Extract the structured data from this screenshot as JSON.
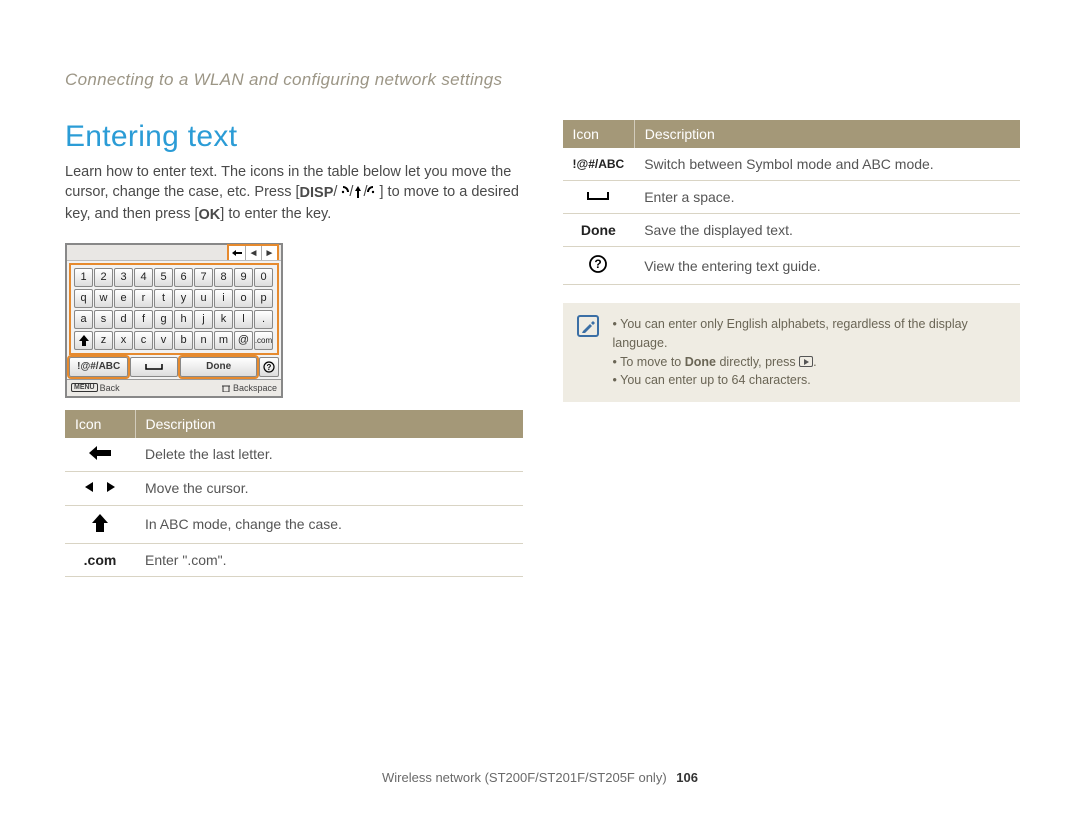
{
  "breadcrumb": "Connecting to a WLAN and configuring network settings",
  "heading": "Entering text",
  "intro_part1": "Learn how to enter text. The icons in the table below let you move the cursor, change the case, etc. Press [",
  "intro_disp": "DISP",
  "intro_part2": "] to move to a desired key, and then press [",
  "intro_ok": "OK",
  "intro_part3": "] to enter the key.",
  "keyboard": {
    "rows": [
      [
        "1",
        "2",
        "3",
        "4",
        "5",
        "6",
        "7",
        "8",
        "9",
        "0"
      ],
      [
        "q",
        "w",
        "e",
        "r",
        "t",
        "y",
        "u",
        "i",
        "o",
        "p"
      ],
      [
        "a",
        "s",
        "d",
        "f",
        "g",
        "h",
        "j",
        "k",
        "l",
        "."
      ],
      [
        "⇧",
        "z",
        "x",
        "c",
        "v",
        "b",
        "n",
        "m",
        "@",
        ".com"
      ]
    ],
    "bottom": {
      "mode": "!@#/ABC",
      "space": "␣",
      "done": "Done",
      "help": "?"
    },
    "footer_left_label": "MENU",
    "footer_left_text": "Back",
    "footer_right_text": "Backspace"
  },
  "table1": {
    "headers": [
      "Icon",
      "Description"
    ],
    "rows": [
      {
        "icon": "back-thick-arrow",
        "desc": "Delete the last letter."
      },
      {
        "icon": "cursor-arrows",
        "desc": "Move the cursor."
      },
      {
        "icon": "shift-arrow",
        "desc": "In ABC mode, change the case."
      },
      {
        "icon": "dotcom",
        "text": ".com",
        "desc": "Enter \".com\"."
      }
    ]
  },
  "table2": {
    "headers": [
      "Icon",
      "Description"
    ],
    "rows": [
      {
        "icon": "mode-text",
        "text": "!@#/ABC",
        "desc": "Switch between Symbol mode and ABC mode."
      },
      {
        "icon": "spacebar",
        "desc": "Enter a space."
      },
      {
        "icon": "done-text",
        "text": "Done",
        "desc": "Save the displayed text."
      },
      {
        "icon": "help-circle",
        "desc": "View the entering text guide."
      }
    ]
  },
  "note": {
    "items": [
      {
        "text": "You can enter only English alphabets, regardless of the display language."
      },
      {
        "prefix": "To move to ",
        "bold": "Done",
        "mid": " directly, press ",
        "tail": "."
      },
      {
        "text": "You can enter up to 64 characters."
      }
    ]
  },
  "footer": {
    "text": "Wireless network (ST200F/ST201F/ST205F only)",
    "page": "106"
  }
}
